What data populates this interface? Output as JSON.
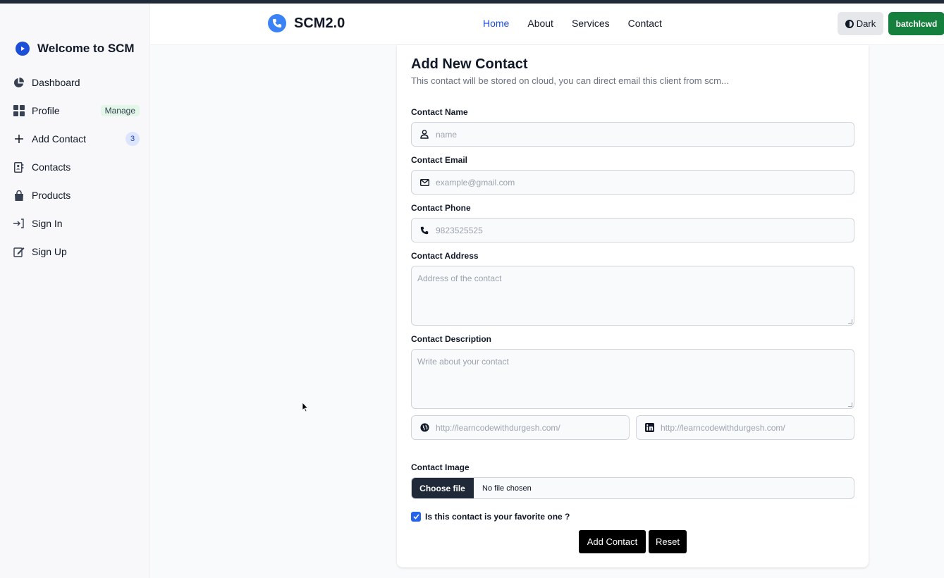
{
  "sidebar": {
    "title": "Welcome to SCM",
    "items": [
      {
        "label": "Dashboard",
        "icon": "pie-chart-icon"
      },
      {
        "label": "Profile",
        "icon": "grid-icon",
        "badge": "Manage"
      },
      {
        "label": "Add Contact",
        "icon": "plus-icon",
        "badge": "3"
      },
      {
        "label": "Contacts",
        "icon": "address-book-icon"
      },
      {
        "label": "Products",
        "icon": "shopping-bag-icon"
      },
      {
        "label": "Sign In",
        "icon": "sign-in-icon"
      },
      {
        "label": "Sign Up",
        "icon": "edit-icon"
      }
    ]
  },
  "navbar": {
    "brand": "SCM2.0",
    "links": [
      "Home",
      "About",
      "Services",
      "Contact"
    ],
    "active_link": "Home",
    "theme_button": "Dark",
    "user_button": "batchlcwd"
  },
  "form": {
    "title": "Add New Contact",
    "subtitle": "This contact will be stored on cloud, you can direct email this client from scm...",
    "name_label": "Contact Name",
    "name_placeholder": "name",
    "email_label": "Contact Email",
    "email_placeholder": "example@gmail.com",
    "phone_label": "Contact Phone",
    "phone_placeholder": "9823525525",
    "address_label": "Contact Address",
    "address_placeholder": "Address of the contact",
    "description_label": "Contact Description",
    "description_placeholder": "Write about your contact",
    "website_placeholder": "http://learncodewithdurgesh.com/",
    "linkedin_placeholder": "http://learncodewithdurgesh.com/",
    "image_label": "Contact Image",
    "choose_file": "Choose file",
    "no_file": "No file chosen",
    "favorite_label": "Is this contact is your favorite one ?",
    "favorite_checked": true,
    "submit": "Add Contact",
    "reset": "Reset"
  },
  "colors": {
    "accent": "#1d4ed8",
    "user_button": "#15803d",
    "checkbox": "#2563eb"
  }
}
